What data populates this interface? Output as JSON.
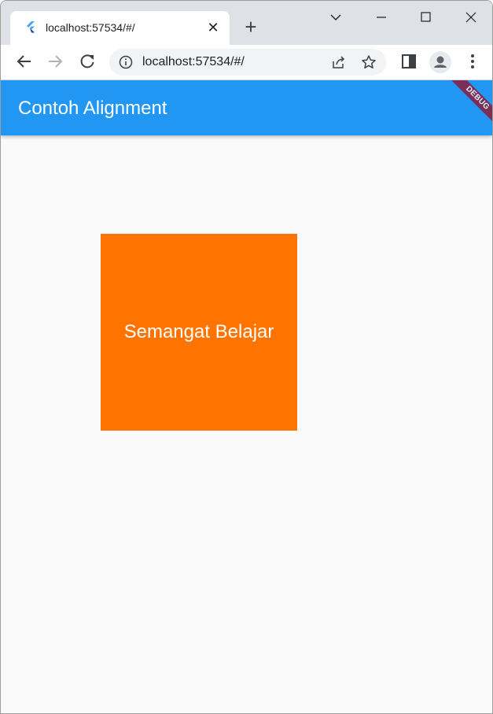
{
  "browser": {
    "tab": {
      "title": "localhost:57534/#/",
      "close_glyph": "✕",
      "favicon": "flutter-icon"
    },
    "new_tab_glyph": "+",
    "window_controls": {
      "dropdown": "chevron-down-icon",
      "minimize": "minimize-icon",
      "maximize": "maximize-icon",
      "close": "close-icon"
    },
    "toolbar": {
      "back": "back-arrow-icon",
      "forward": "forward-arrow-icon",
      "reload": "reload-icon",
      "url": "localhost:57534/#/",
      "site_info": "info-icon",
      "share": "share-icon",
      "bookmark": "star-icon",
      "side_panel": "side-panel-icon",
      "profile": "avatar-icon",
      "menu": "kebab-menu-icon"
    }
  },
  "app": {
    "title": "Contoh Alignment",
    "debug_banner": "DEBUG",
    "box_text": "Semangat Belajar",
    "colors": {
      "appbar": "#2196f3",
      "box": "#ff7300",
      "background": "#fafafa",
      "debug_banner": "#8b1d3b"
    }
  }
}
